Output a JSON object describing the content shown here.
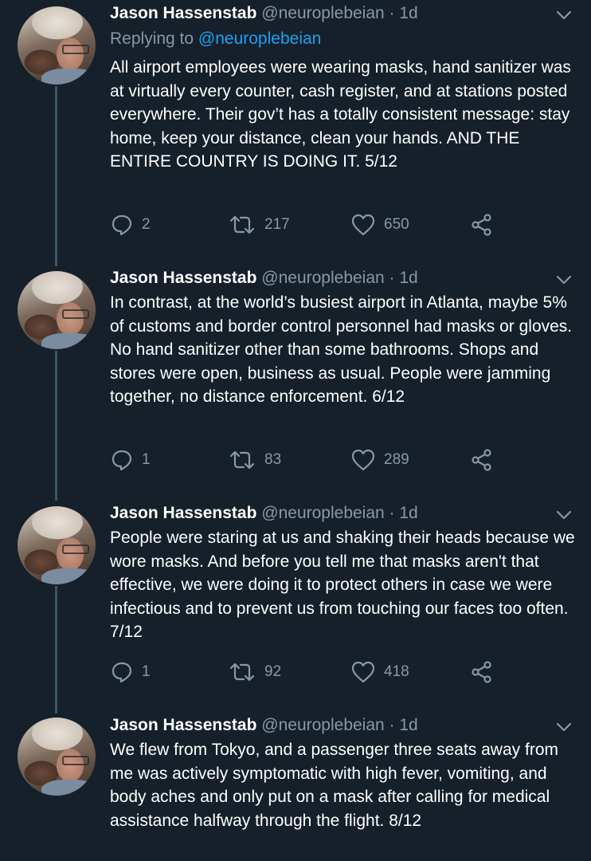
{
  "colors": {
    "background": "#15202b",
    "text": "#ffffff",
    "secondary": "#8899a6",
    "link": "#1da1f2",
    "thread_line": "#3d5466"
  },
  "tweets": [
    {
      "name": "Jason Hassenstab",
      "handle": "@neuroplebeian",
      "time": "· 1d",
      "reply_label": "Replying to",
      "reply_mention": "@neuroplebeian",
      "text": "All airport employees were wearing masks, hand sanitizer was at virtually every counter, cash register, and at stations posted everywhere. Their gov’t has a totally consistent message: stay home, keep your distance, clean your hands. AND THE ENTIRE COUNTRY IS DOING IT. 5/12",
      "replies": "2",
      "retweets": "217",
      "likes": "650"
    },
    {
      "name": "Jason Hassenstab",
      "handle": "@neuroplebeian",
      "time": "· 1d",
      "text": "In contrast, at the world’s busiest airport in Atlanta, maybe 5% of customs and border control personnel had masks or gloves. No hand sanitizer other than some bathrooms. Shops and stores were open, business as usual. People were jamming together, no distance enforcement. 6/12",
      "replies": "1",
      "retweets": "83",
      "likes": "289"
    },
    {
      "name": "Jason Hassenstab",
      "handle": "@neuroplebeian",
      "time": "· 1d",
      "text": "People were staring at us and shaking their heads because we wore masks. And before you tell me that masks aren't that effective, we were doing it to protect others in case we were infectious and to prevent us from touching our faces too often. 7/12",
      "replies": "1",
      "retweets": "92",
      "likes": "418"
    },
    {
      "name": "Jason Hassenstab",
      "handle": "@neuroplebeian",
      "time": "· 1d",
      "text": "We flew from Tokyo, and a passenger three seats away from me was actively symptomatic with high fever, vomiting, and body aches and only put on a mask after calling for medical assistance halfway through the flight. 8/12"
    }
  ],
  "icons": [
    "reply-icon",
    "retweet-icon",
    "like-icon",
    "share-icon",
    "chevron-down-icon"
  ]
}
